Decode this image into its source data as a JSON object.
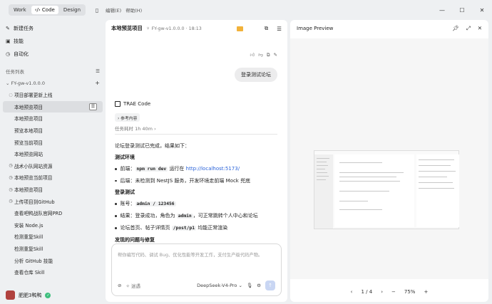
{
  "titlebar": {
    "modes": [
      "Work",
      "Code",
      "Design"
    ],
    "active_mode": "Code",
    "menus": [
      "编辑(E)",
      "帮助(H)"
    ]
  },
  "sidebar": {
    "nav": [
      {
        "label": "新建任务",
        "icon": "edit-icon"
      },
      {
        "label": "技能",
        "icon": "skill-icon"
      },
      {
        "label": "自动化",
        "icon": "clock-icon"
      }
    ],
    "section_title": "任务列表",
    "project": "FY-gw-v1.0.0.0",
    "tasks": [
      {
        "label": "项目部署更新上线",
        "indent": 1,
        "icon": "spinner-icon"
      },
      {
        "label": "本地预览项目",
        "indent": 2,
        "selected": true
      },
      {
        "label": "本地预览项目",
        "indent": 2
      },
      {
        "label": "预览本地项目",
        "indent": 2
      },
      {
        "label": "预览当前项目",
        "indent": 2
      },
      {
        "label": "本地预览网站",
        "indent": 2
      },
      {
        "label": "战术小队网站资源",
        "indent": 1,
        "icon": "clock-icon"
      },
      {
        "label": "本地预览当前项目",
        "indent": 1,
        "icon": "clock-icon"
      },
      {
        "label": "本地预览项目",
        "indent": 1,
        "icon": "clock-icon"
      },
      {
        "label": "上传项目到GitHub",
        "indent": 1,
        "icon": "clock-icon"
      },
      {
        "label": "查看吧鸭战队官网PRD",
        "indent": 2
      },
      {
        "label": "安装 Node.js",
        "indent": 2
      },
      {
        "label": "检测重复Skill",
        "indent": 2
      },
      {
        "label": "检测重复Skill",
        "indent": 2
      },
      {
        "label": "分析 GitHub 技能",
        "indent": 2
      },
      {
        "label": "查看仓库 Skill",
        "indent": 2
      }
    ],
    "user_name": "肥肥3鸭鸭"
  },
  "chat": {
    "title": "本地预览项目",
    "branch": "FY-gw-v1.0.0.0 · 18:13",
    "user_message": "登录测试论坛",
    "agent_name": "TRAE Code",
    "reference_label": "参考内容",
    "elapsed": "任务耗时 1h 40m",
    "summary": "论坛登录测试已完成，结果如下：",
    "section1": "测试环境",
    "s1_b1_prefix": "前端：",
    "s1_b1_code": "npm run dev",
    "s1_b1_mid": "运行在",
    "s1_b1_link": "http://localhost:5173/",
    "s1_b2": "后端：未检测到 NestJS 服务，开发环境走前端 Mock 兜底",
    "section2": "登录测试",
    "s2_b1_prefix": "账号：",
    "s2_b1_code": "admin / 123456",
    "s2_b2_prefix": "结果：登录成功，角色为",
    "s2_b2_code": "admin",
    "s2_b2_suffix": "，可正常跳转个人中心和论坛",
    "s2_b3_prefix": "论坛首页、帖子详情页",
    "s2_b3_code": "/post/p1",
    "s2_b3_suffix": "均能正常渲染",
    "section3": "发现的问题与修复",
    "input_placeholder": "帮你编写代码、调试 Bug、优化性能等开发工作，支付生产级代码产物。",
    "speed_label": "迷遇",
    "model": "DeepSeek-V4-Pro"
  },
  "preview": {
    "title": "Image Preview",
    "page": "1 / 4",
    "zoom": "75%"
  }
}
